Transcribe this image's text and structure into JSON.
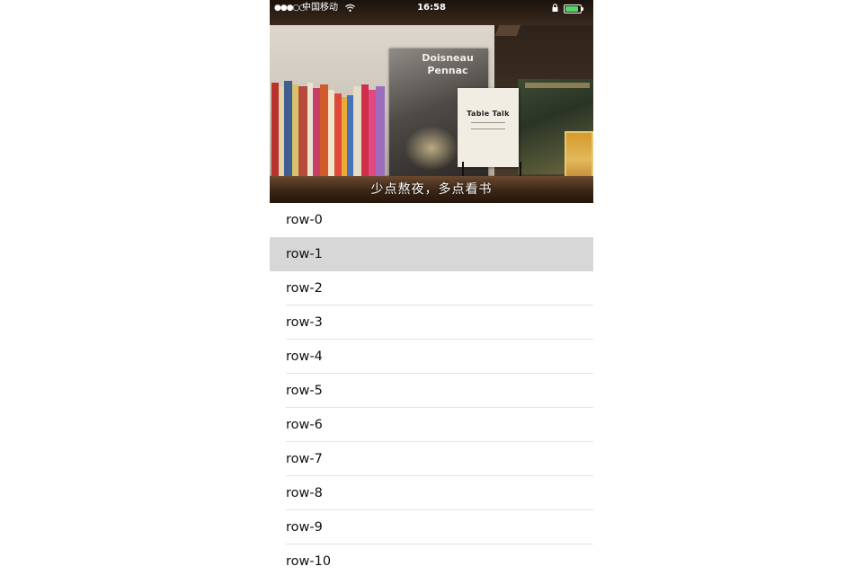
{
  "status_bar": {
    "signal": "●●●○○",
    "carrier": "中国移动",
    "wifi_icon": "wifi-icon",
    "time": "16:58",
    "battery_color": "#4cd964"
  },
  "header": {
    "caption": "少点熬夜，多点看书",
    "poster_title_line1": "Doisneau",
    "poster_title_line2": "Pennac",
    "book_title": "Table Talk"
  },
  "table": {
    "selected_index": 1,
    "rows": [
      {
        "label": "row-0"
      },
      {
        "label": "row-1"
      },
      {
        "label": "row-2"
      },
      {
        "label": "row-3"
      },
      {
        "label": "row-4"
      },
      {
        "label": "row-5"
      },
      {
        "label": "row-6"
      },
      {
        "label": "row-7"
      },
      {
        "label": "row-8"
      },
      {
        "label": "row-9"
      },
      {
        "label": "row-10"
      }
    ]
  }
}
